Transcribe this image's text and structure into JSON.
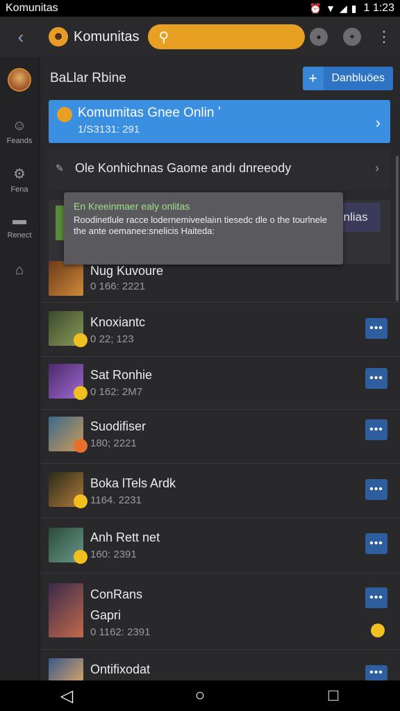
{
  "status_bar": {
    "title": "Komunitas",
    "time": "1 1:23"
  },
  "app_bar": {
    "back_icon": "back-arrow-icon",
    "title": "Komunitas",
    "search_icon": "search-icon"
  },
  "rail": {
    "items": [
      {
        "label": "",
        "icon": "avatar"
      },
      {
        "label": "Feands",
        "icon": "people-icon"
      },
      {
        "label": "Fenа",
        "icon": "group-icon"
      },
      {
        "label": "Renect",
        "icon": "chat-icon"
      },
      {
        "label": "",
        "icon": "home-icon"
      }
    ]
  },
  "section": {
    "heading": "BaLlar Rbine",
    "button_label": "Danbluöes"
  },
  "banner": {
    "title": "Komumitas Gnee Onlin ʼ",
    "subtitle": "1/S3131: 291"
  },
  "row_link": {
    "text": "Ole Konhichnas Gaome andı dnreeody"
  },
  "promo": {
    "button_label": "nlias"
  },
  "tooltip": {
    "title": "En Kreeinmaer ealy onlitas",
    "body": "Roodinetlule racce lodernemiveelaiın tiesedc dle o the tourlnele the ante oemanee:snelicis Haiteda:"
  },
  "list": [
    {
      "name": "Nug Kuvoure",
      "meta": "0 166: 2221"
    },
    {
      "name": "Knoxiantc",
      "meta": "0 22; 123"
    },
    {
      "name": "Sat Ronhie",
      "meta": "0 162: 2M7"
    },
    {
      "name": "Suodifiser",
      "meta": "180; 2221"
    },
    {
      "name": "Boka lTels Ardk",
      "meta": "1164. 2231"
    },
    {
      "name": "Anh Rett net",
      "meta": "160: 2391"
    },
    {
      "name": "ConRans",
      "name2": "Gapri",
      "meta": "0 1162: 2391"
    },
    {
      "name": "Ontifixodat",
      "meta": ""
    }
  ],
  "more_label": "•••"
}
